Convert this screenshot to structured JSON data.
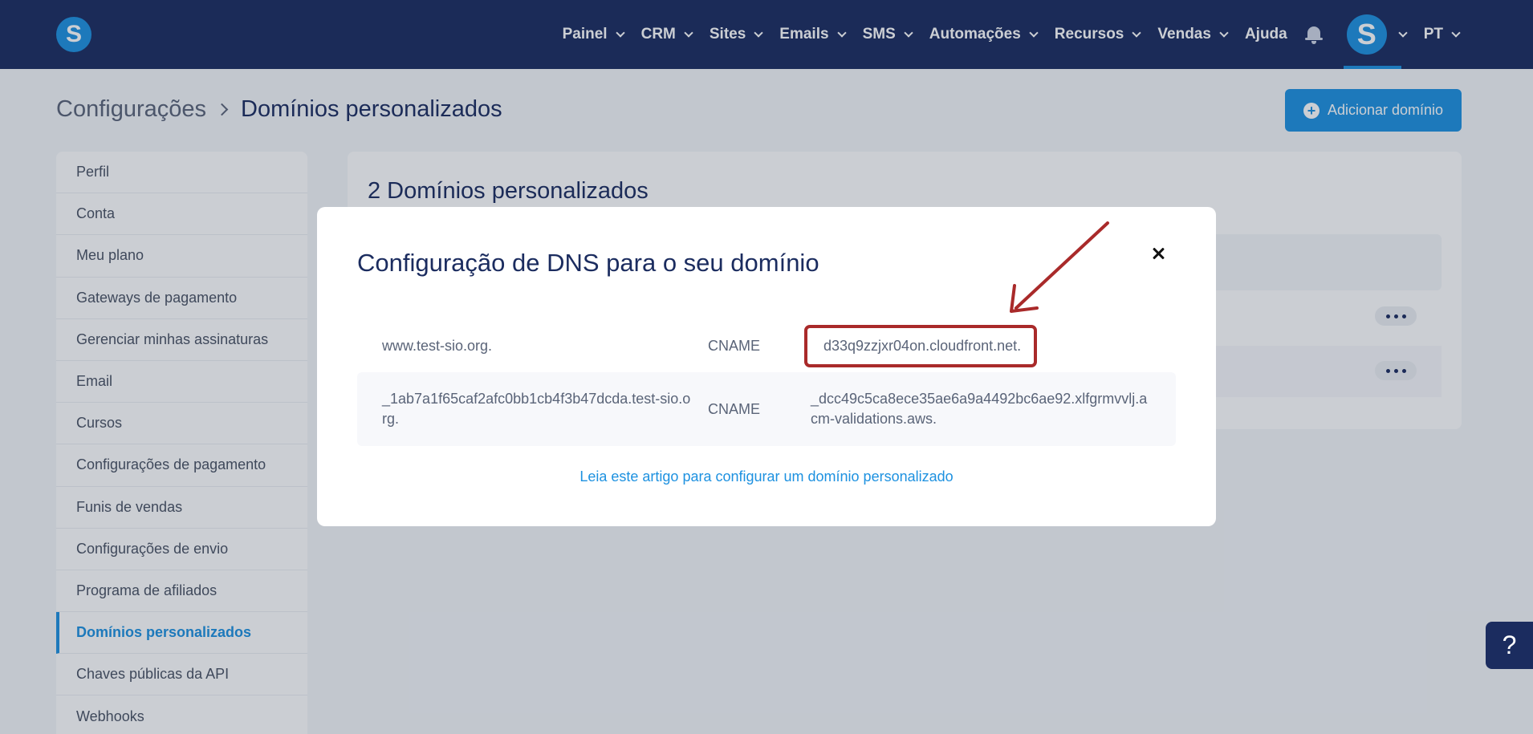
{
  "brand": {
    "logo_letter": "S",
    "primary": "#1d91e0",
    "navy": "#1b2c5f",
    "highlight": "#a92a2a"
  },
  "nav": {
    "items": [
      {
        "label": "Painel"
      },
      {
        "label": "CRM"
      },
      {
        "label": "Sites"
      },
      {
        "label": "Emails"
      },
      {
        "label": "SMS"
      },
      {
        "label": "Automações"
      },
      {
        "label": "Recursos"
      },
      {
        "label": "Vendas"
      }
    ],
    "help": "Ajuda",
    "avatar_letter": "S",
    "language": "PT"
  },
  "breadcrumb": {
    "parent": "Configurações",
    "current": "Domínios personalizados"
  },
  "add_button": {
    "icon": "plus-circle-icon",
    "label": "Adicionar domínio"
  },
  "sidebar": {
    "items": [
      {
        "label": "Perfil"
      },
      {
        "label": "Conta"
      },
      {
        "label": "Meu plano"
      },
      {
        "label": "Gateways de pagamento"
      },
      {
        "label": "Gerenciar minhas assinaturas"
      },
      {
        "label": "Email"
      },
      {
        "label": "Cursos"
      },
      {
        "label": "Configurações de pagamento"
      },
      {
        "label": "Funis de vendas"
      },
      {
        "label": "Configurações de envio"
      },
      {
        "label": "Programa de afiliados"
      },
      {
        "label": "Domínios personalizados"
      },
      {
        "label": "Chaves públicas da API"
      },
      {
        "label": "Webhooks"
      }
    ],
    "active_label": "Domínios personalizados"
  },
  "panel": {
    "title": "2 Domínios personalizados"
  },
  "modal": {
    "title": "Configuração de DNS para o seu domínio",
    "records": [
      {
        "host": "www.test-sio.org.",
        "type": "CNAME",
        "value": "d33q9zzjxr04on.cloudfront.net."
      },
      {
        "host": "_1ab7a1f65caf2afc0bb1cb4f3b47dcda.test-sio.org.",
        "type": "CNAME",
        "value": "_dcc49c5ca8ece35ae6a9a4492bc6ae92.xlfgrmvvlj.acm-validations.aws."
      }
    ],
    "help_link": "Leia este artigo para configurar um domínio personalizado"
  },
  "help_button": {
    "label": "?"
  }
}
